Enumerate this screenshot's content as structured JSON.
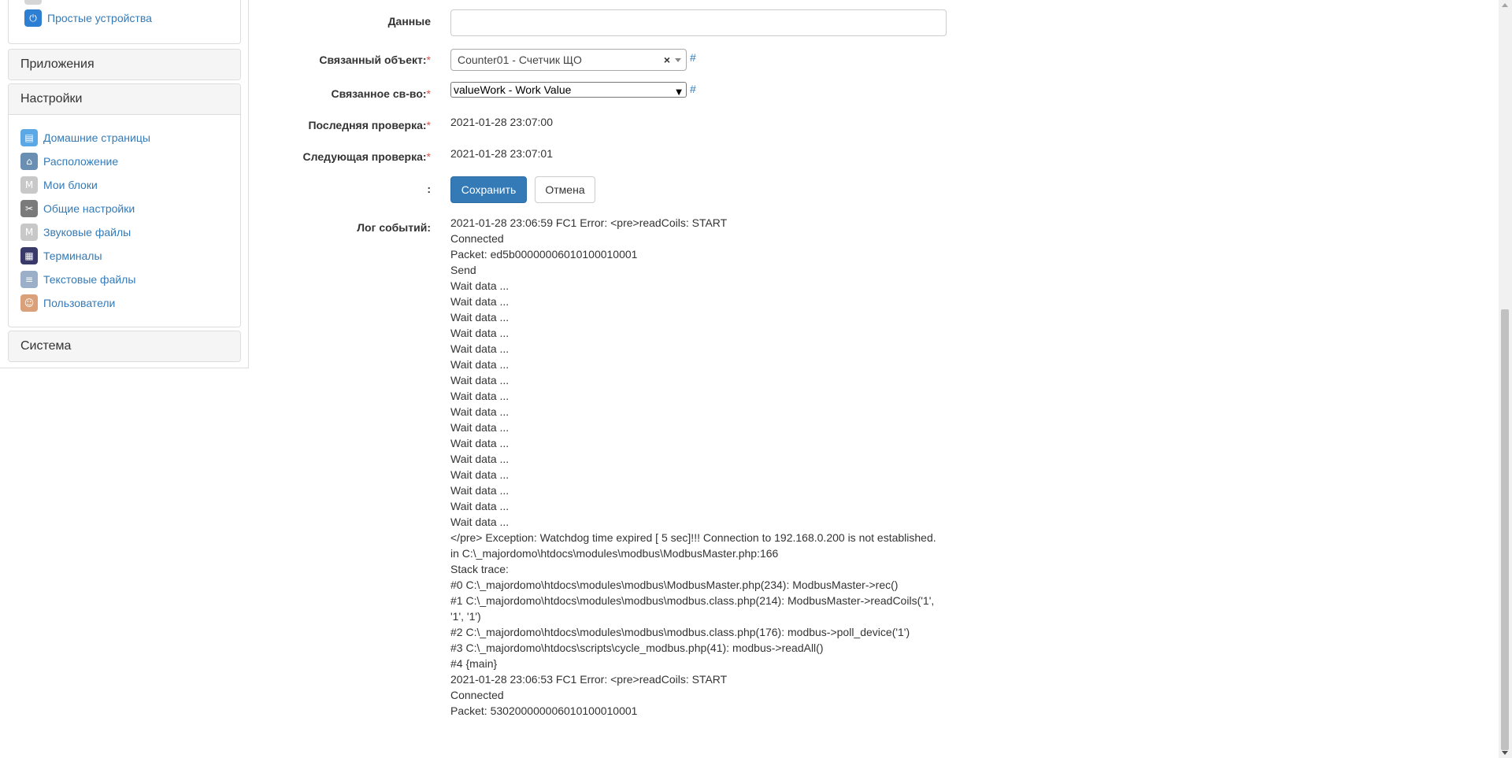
{
  "sidebar": {
    "top_item": "Простые устройства",
    "panels": {
      "apps": "Приложения",
      "settings": "Настройки",
      "system": "Система"
    },
    "settings_items": [
      {
        "label": "Домашние страницы",
        "icon": "document-icon",
        "color": "#5aa9e6"
      },
      {
        "label": "Расположение",
        "icon": "house-icon",
        "color": "#6b8fb3"
      },
      {
        "label": "Мои блоки",
        "icon": "blocks-icon",
        "color": "#c8c8c8"
      },
      {
        "label": "Общие настройки",
        "icon": "tools-icon",
        "color": "#7a7a7a"
      },
      {
        "label": "Звуковые файлы",
        "icon": "sound-icon",
        "color": "#c8c8c8"
      },
      {
        "label": "Терминалы",
        "icon": "terminal-icon",
        "color": "#3a3a6a"
      },
      {
        "label": "Текстовые файлы",
        "icon": "text-file-icon",
        "color": "#9bb0c8"
      },
      {
        "label": "Пользователи",
        "icon": "users-icon",
        "color": "#d9a07a"
      }
    ]
  },
  "form": {
    "data_label": "Данные",
    "data_value": "",
    "linked_object_label": "Связанный объект:",
    "linked_object_value": "Counter01 - Счетчик ЩО",
    "linked_prop_label": "Связанное св-во:",
    "linked_prop_value": "valueWork - Work Value",
    "last_check_label": "Последняя проверка:",
    "last_check_value": "2021-01-28 23:07:00",
    "next_check_label": "Следующая проверка:",
    "next_check_value": "2021-01-28 23:07:01",
    "buttons_label": ":",
    "save_label": "Сохранить",
    "cancel_label": "Отмена",
    "hash": "#",
    "required_mark": "*",
    "clear_mark": "×",
    "log_label": "Лог событий:"
  },
  "log_lines": [
    "2021-01-28 23:06:59 FC1 Error: <pre>readCoils: START",
    "Connected",
    "Packet: ed5b00000006010100010001",
    "Send",
    "Wait data ...",
    "Wait data ...",
    "Wait data ...",
    "Wait data ...",
    "Wait data ...",
    "Wait data ...",
    "Wait data ...",
    "Wait data ...",
    "Wait data ...",
    "Wait data ...",
    "Wait data ...",
    "Wait data ...",
    "Wait data ...",
    "Wait data ...",
    "Wait data ...",
    "Wait data ...",
    "</pre> Exception: Watchdog time expired [ 5 sec]!!! Connection to 192.168.0.200 is not established.",
    "in C:\\_majordomo\\htdocs\\modules\\modbus\\ModbusMaster.php:166",
    "Stack trace:",
    "#0 C:\\_majordomo\\htdocs\\modules\\modbus\\ModbusMaster.php(234): ModbusMaster->rec()",
    "#1 C:\\_majordomo\\htdocs\\modules\\modbus\\modbus.class.php(214): ModbusMaster->readCoils('1', '1', '1')",
    "#2 C:\\_majordomo\\htdocs\\modules\\modbus\\modbus.class.php(176): modbus->poll_device('1')",
    "#3 C:\\_majordomo\\htdocs\\scripts\\cycle_modbus.php(41): modbus->readAll()",
    "#4 {main}",
    "2021-01-28 23:06:53 FC1 Error: <pre>readCoils: START",
    "Connected",
    "Packet: 530200000006010100010001"
  ]
}
